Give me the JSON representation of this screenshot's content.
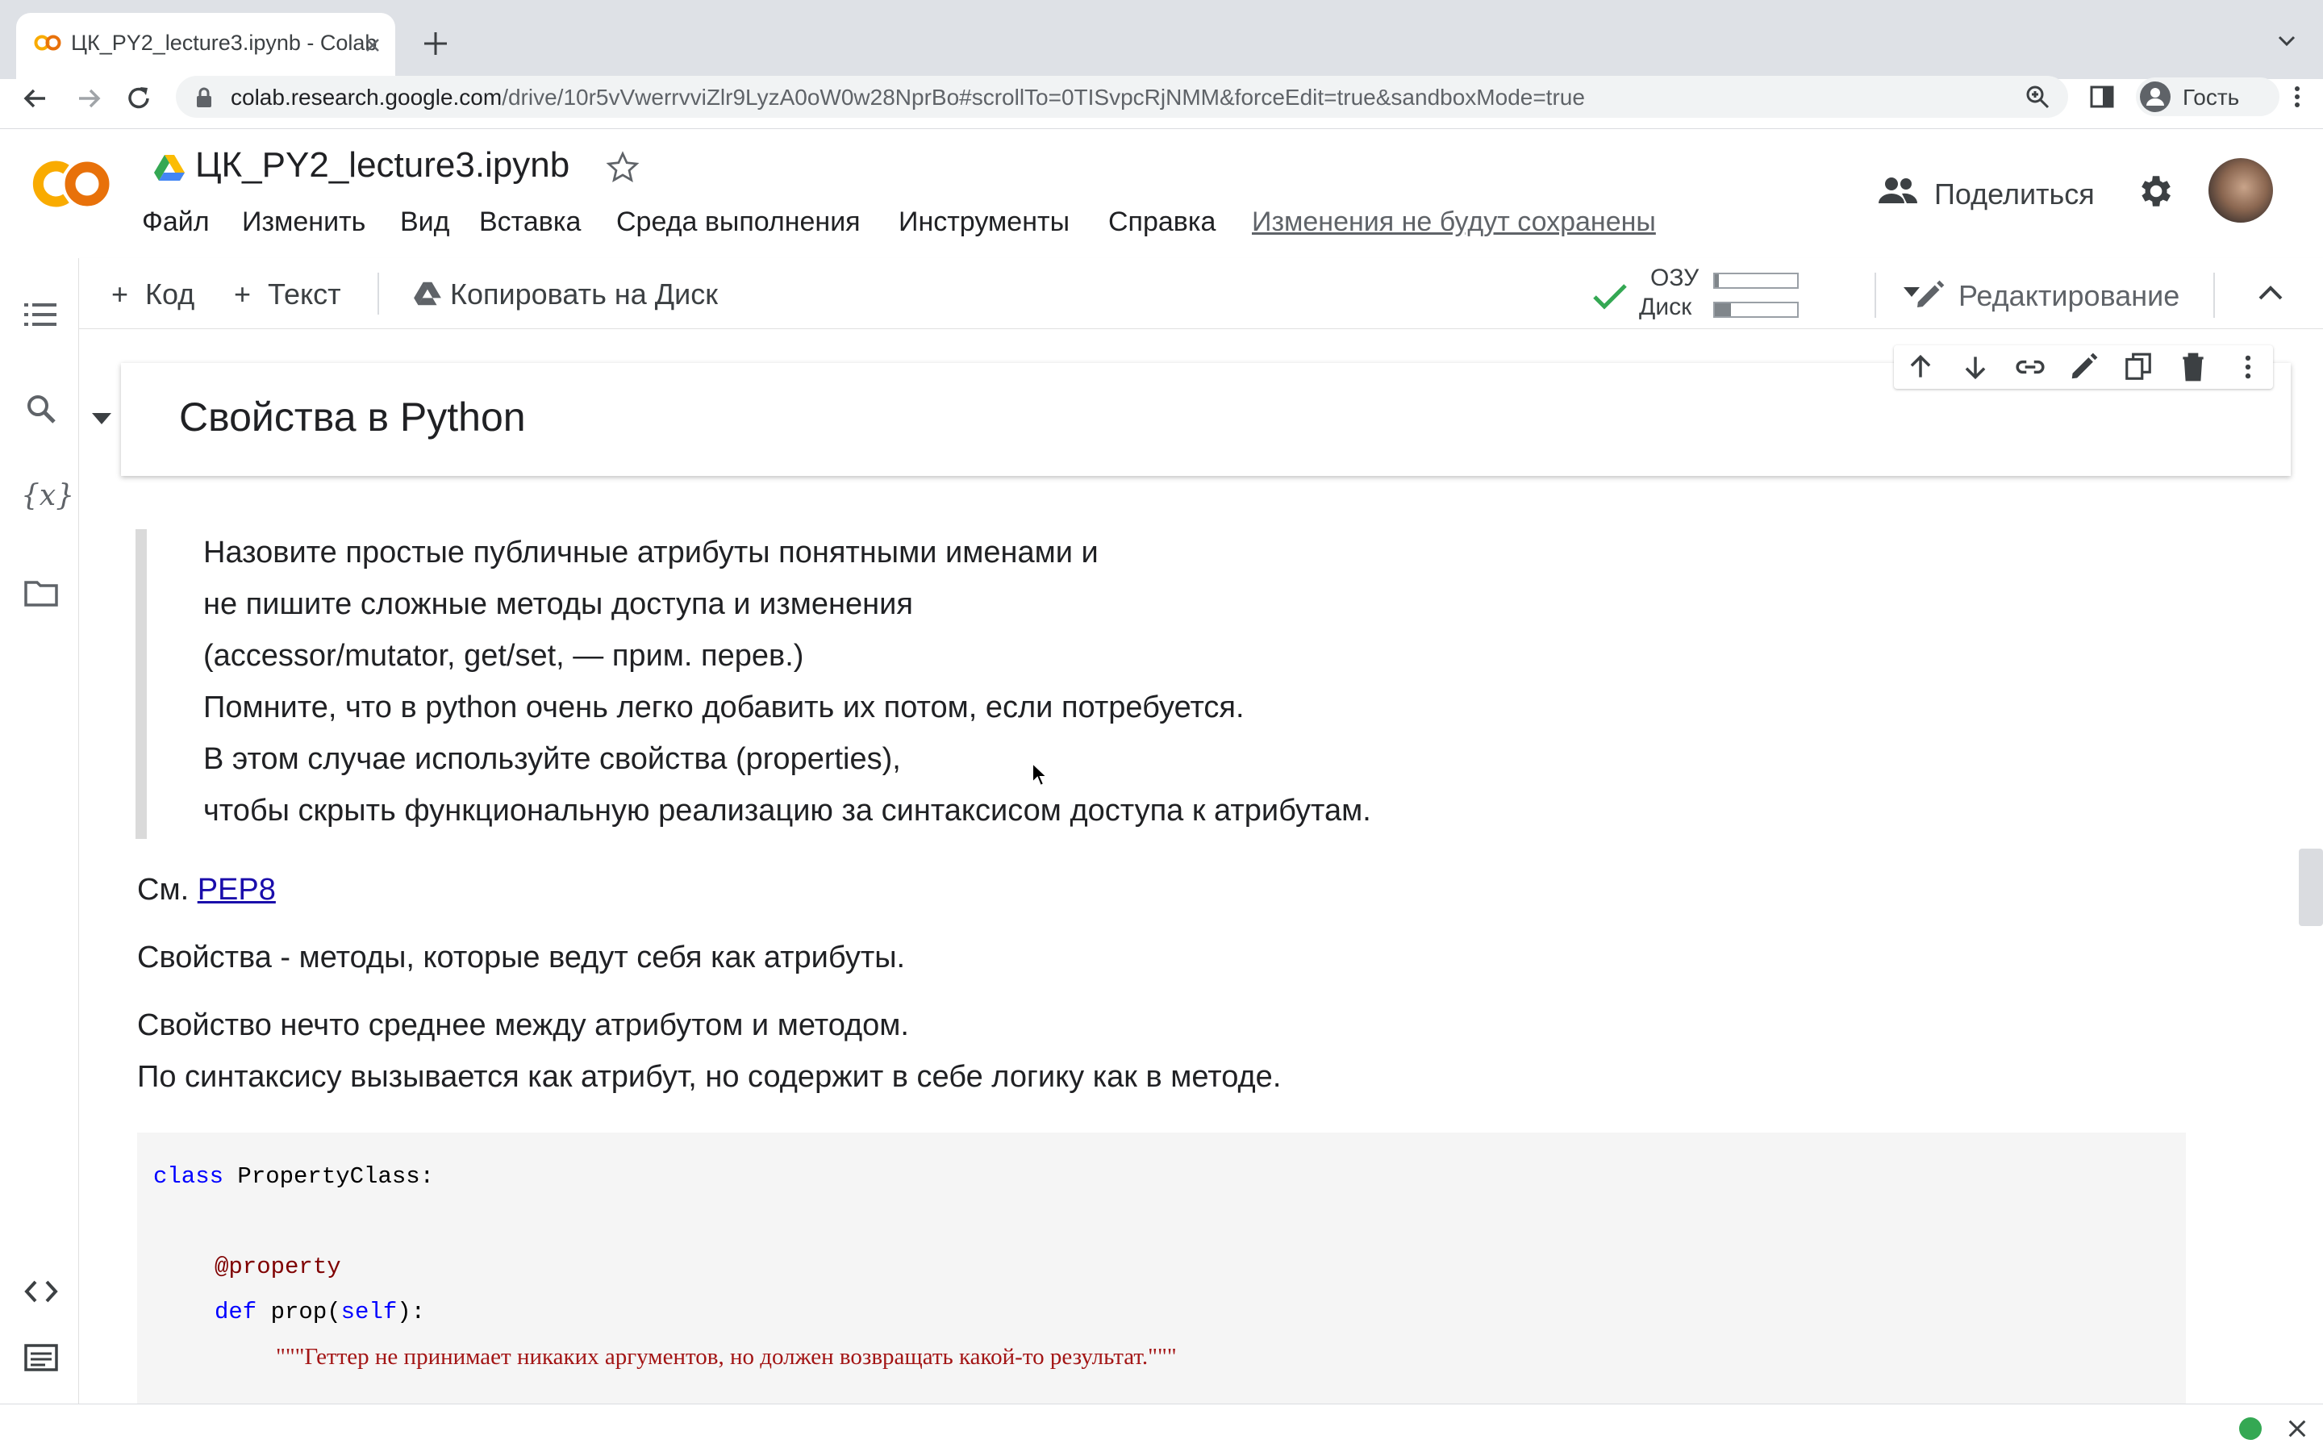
{
  "browser": {
    "tab_title": "ЦК_PY2_lecture3.ipynb - Colab",
    "url_host": "colab.research.google.com",
    "url_path": "/drive/10r5vVwerrvviZlr9LyzA0oW0w28NprBo#scrollTo=0TISvpcRjNMM&forceEdit=true&sandboxMode=true",
    "profile_label": "Гость"
  },
  "colab": {
    "logo_text": "CO",
    "notebook_title": "ЦК_PY2_lecture3.ipynb",
    "menu": [
      "Файл",
      "Изменить",
      "Вид",
      "Вставка",
      "Среда выполнения",
      "Инструменты",
      "Справка"
    ],
    "unsaved_notice": "Изменения не будут сохранены",
    "share_label": "Поделиться"
  },
  "toolbar": {
    "add_code": "Код",
    "add_text": "Текст",
    "copy_to_drive": "Копировать на Диск",
    "ram_label": "ОЗУ",
    "disk_label": "Диск",
    "ram_usage": 0.05,
    "disk_usage": 0.2,
    "edit_mode": "Редактирование"
  },
  "cells": {
    "heading": "Свойства в Python",
    "quote_lines": [
      "Назовите простые публичные атрибуты понятными именами и",
      "не пишите сложные методы доступа и изменения",
      "(accessor/mutator, get/set, — прим. перев.)",
      "Помните, что в python очень легко добавить их потом, если потребуется.",
      "В этом случае используйте свойства (properties),",
      "чтобы скрыть функциональную реализацию за синтаксисом доступа к атрибутам."
    ],
    "see_prefix": "См.",
    "see_link": "PEP8",
    "para1": "Свойства - методы, которые ведут себя как атрибуты.",
    "para2_line1": "Свойство нечто среднее между атрибутом и методом.",
    "para2_line2": "По синтаксису вызывается как атрибут, но содержит в себе логику как в методе.",
    "code": {
      "kw_class": "class",
      "class_name": " PropertyClass:",
      "decorator": "@property",
      "kw_def": "def",
      "def_name": " prop(",
      "self_kw": "self",
      "def_end": "):",
      "docstring": "\"\"\"Геттер не принимает никаких аргументов, но должен возвращать какой-то результат.\"\"\""
    }
  },
  "colors": {
    "accent_orange": "#f9ab00",
    "status_green": "#34a853",
    "link": "#1a0dab"
  }
}
